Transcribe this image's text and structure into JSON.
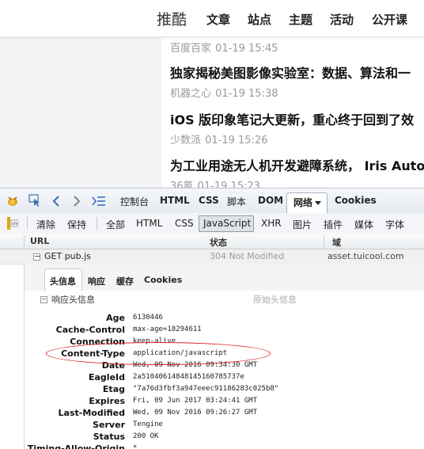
{
  "site": {
    "brand": "推酷",
    "nav": [
      "文章",
      "站点",
      "主题",
      "活动",
      "公开课"
    ],
    "articles": [
      {
        "title": "",
        "source": "百度百家",
        "time": "01-19 15:45"
      },
      {
        "title": "独家揭秘美图影像实验室：数据、算法和一",
        "source": "机器之心",
        "time": "01-19 15:38"
      },
      {
        "title": "iOS 版印象笔记大更新，重心终于回到了效",
        "source": "少数派",
        "time": "01-19 15:26"
      },
      {
        "title": "为工业用途无人机开发避障系统， Iris Auto",
        "source": "36氪",
        "time": "01-19 15:23"
      }
    ]
  },
  "devtools": {
    "main_tabs": [
      "控制台",
      "HTML",
      "CSS",
      "脚本",
      "DOM",
      "网络",
      "Cookies"
    ],
    "active_main_tab": "网络",
    "filters": [
      "清除",
      "保持",
      "全部",
      "HTML",
      "CSS",
      "JavaScript",
      "XHR",
      "图片",
      "插件",
      "媒体",
      "字体"
    ],
    "active_filter": "JavaScript",
    "columns": {
      "url": "URL",
      "status": "状态",
      "domain": "域"
    },
    "request": {
      "method_url": "GET pub.js",
      "status": "304 Not Modified",
      "domain": "asset.tuicool.com"
    },
    "detail_tabs": [
      "头信息",
      "响应",
      "缓存",
      "Cookies"
    ],
    "active_detail_tab": "头信息",
    "section_title": "响应头信息",
    "raw_headers_label": "原始头信息",
    "headers": [
      {
        "key": "Age",
        "value": "6130446"
      },
      {
        "key": "Cache-Control",
        "value": "max-age=18294611"
      },
      {
        "key": "Connection",
        "value": "keep-alive"
      },
      {
        "key": "Content-Type",
        "value": "application/javascript"
      },
      {
        "key": "Date",
        "value": "Wed, 09 Nov 2016 09:34:30 GMT"
      },
      {
        "key": "EagleId",
        "value": "2a51040614848145160785737e"
      },
      {
        "key": "Etag",
        "value": "\"7a76d3fbf3a947eeec91186283c025b8\""
      },
      {
        "key": "Expires",
        "value": "Fri, 09 Jun 2017 03:24:41 GMT"
      },
      {
        "key": "Last-Modified",
        "value": "Wed, 09 Nov 2016 09:26:27 GMT"
      },
      {
        "key": "Server",
        "value": "Tengine"
      },
      {
        "key": "Status",
        "value": "200 OK"
      },
      {
        "key": "Timing-Allow-Origin",
        "value": "*"
      }
    ],
    "highlight_color": "#dd2222",
    "icons": [
      "firebug-icon",
      "inspect-icon",
      "back-arrow-icon",
      "forward-arrow-icon",
      "panel-list-icon",
      "xhr-icon",
      "dropdown-arrow-icon",
      "collapse-icon"
    ]
  }
}
